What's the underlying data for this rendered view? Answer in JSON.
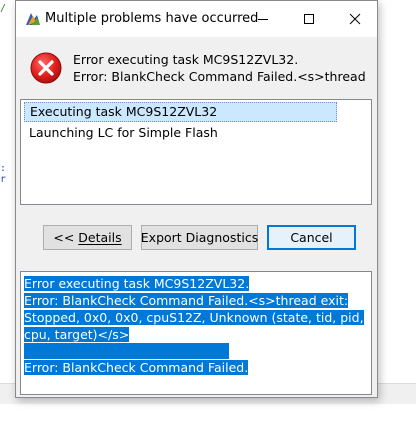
{
  "window": {
    "title": "Multiple problems have occurred"
  },
  "message": {
    "line1": "Error executing task MC9S12ZVL32.",
    "line2": "Error:  BlankCheck Command Failed.<s>thread"
  },
  "task_list": [
    {
      "label": "Executing task MC9S12ZVL32"
    },
    {
      "label": "Launching LC for Simple Flash"
    }
  ],
  "buttons": {
    "details_prefix": "<< ",
    "details_label": "Details",
    "export_label": "Export Diagnostics",
    "cancel_label": "Cancel"
  },
  "details": {
    "lines": [
      "Error executing task MC9S12ZVL32.",
      "Error:  BlankCheck Command Failed.<s>thread exit:",
      "Stopped, 0x0, 0x0, cpuS12Z, Unknown (state, tid, pid,",
      "cpu, target)</s>",
      "",
      "Error: BlankCheck Command Failed."
    ]
  },
  "colors": {
    "selection": "#0078d7",
    "list_selection": "#cce8ff",
    "error_icon": "#e81123"
  },
  "icons": {
    "app": "app-logo-icon",
    "error": "error-icon",
    "minimize": "minimize-icon",
    "maximize": "maximize-icon",
    "close": "close-icon"
  }
}
